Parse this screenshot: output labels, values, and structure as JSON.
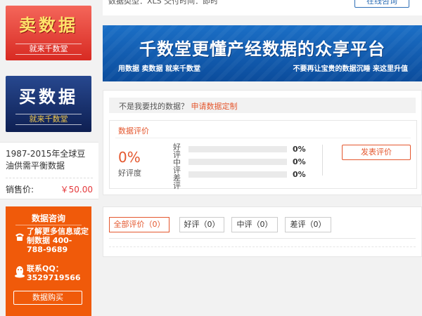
{
  "ads": {
    "sell": {
      "title": "卖数据",
      "sub": "就来千数堂"
    },
    "buy": {
      "title": "买数据",
      "sub": "就来千数堂"
    }
  },
  "product": {
    "title": "1987-2015年全球豆油供需平衡数据",
    "price_label": "销售价:",
    "price": "￥50.00"
  },
  "consult": {
    "title": "数据咨询",
    "info": "了解更多信息或定制数据 400-788-9689",
    "qq": "联系QQ：3529719566",
    "buy_button": "数据购买"
  },
  "topbar": {
    "meta": "数据类型：XLS    交付时间：即时",
    "consult_online": "在线咨询"
  },
  "banner": {
    "title": "千数堂更懂产经数据的众享平台",
    "left": "用数据  卖数据  就来千数堂",
    "right": "不要再让宝贵的数据沉睡  来这里升值"
  },
  "evaluation": {
    "not_found_prefix": "不是我要找的数据？",
    "not_found_link": "申请数据定制",
    "title": "数据评价",
    "rate": "0%",
    "rate_label": "好评度",
    "rows": [
      {
        "label": "好评",
        "pct": "0%",
        "value": 0
      },
      {
        "label": "中评",
        "pct": "0%",
        "value": 0
      },
      {
        "label": "差评",
        "pct": "0%",
        "value": 0
      }
    ],
    "publish_button": "发表评价"
  },
  "filters": [
    {
      "label": "全部评价（0）",
      "active": true
    },
    {
      "label": "好评（0）",
      "active": false
    },
    {
      "label": "中评（0）",
      "active": false
    },
    {
      "label": "差评（0）",
      "active": false
    }
  ],
  "colors": {
    "accent": "#e4572e",
    "consult_bg": "#f05a0a",
    "banner_bg": "#1b6fc6"
  }
}
